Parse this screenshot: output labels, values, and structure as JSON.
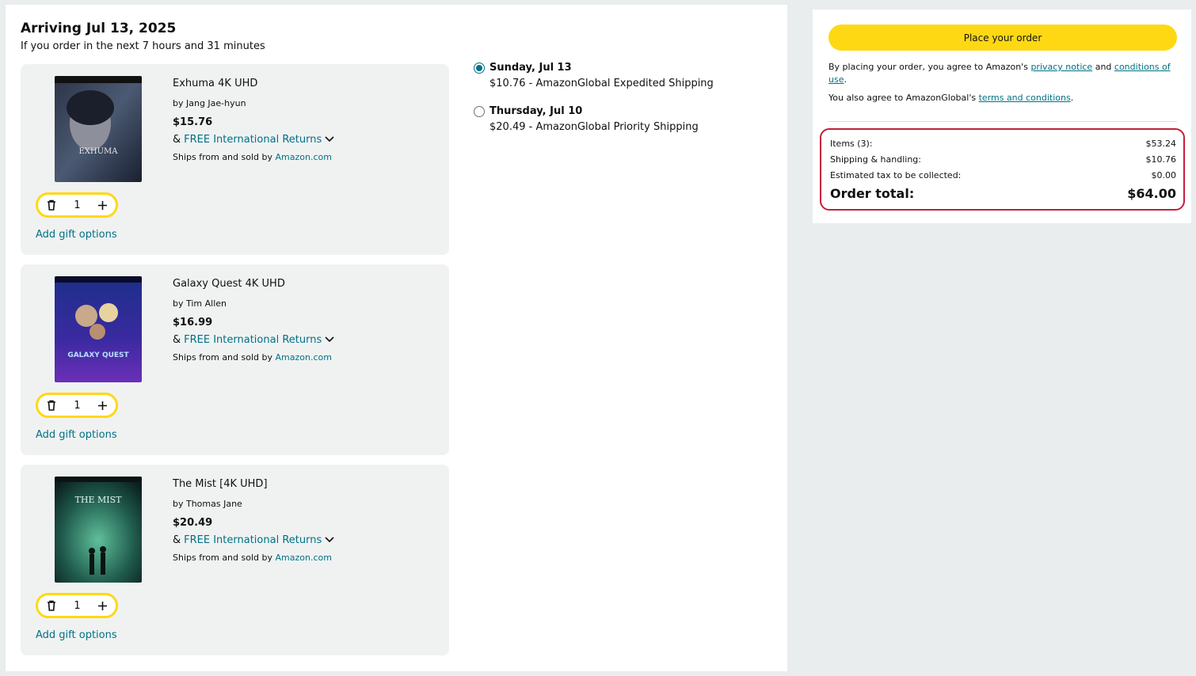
{
  "delivery": {
    "heading": "Arriving Jul 13, 2025",
    "subheading": "If you order in the next 7 hours and 31 minutes"
  },
  "items": [
    {
      "title": "Exhuma 4K UHD",
      "by": "by Jang Jae-hyun",
      "price": "$15.76",
      "returns_prefix": "& ",
      "returns_link": "FREE International Returns",
      "ships_prefix": "Ships from and sold by ",
      "seller": "Amazon.com",
      "quantity": "1",
      "gift": "Add gift options",
      "cover_text": "EXHUMA"
    },
    {
      "title": "Galaxy Quest 4K UHD",
      "by": "by Tim Allen",
      "price": "$16.99",
      "returns_prefix": "& ",
      "returns_link": "FREE International Returns",
      "ships_prefix": "Ships from and sold by ",
      "seller": "Amazon.com",
      "quantity": "1",
      "gift": "Add gift options",
      "cover_text": "GALAXY QUEST"
    },
    {
      "title": "The Mist [4K UHD]",
      "by": "by Thomas Jane",
      "price": "$20.49",
      "returns_prefix": "& ",
      "returns_link": "FREE International Returns",
      "ships_prefix": "Ships from and sold by ",
      "seller": "Amazon.com",
      "quantity": "1",
      "gift": "Add gift options",
      "cover_text": "THE MIST"
    }
  ],
  "shipping_options": [
    {
      "date": "Sunday, Jul 13",
      "desc": "$10.76 - AmazonGlobal Expedited Shipping",
      "selected": true
    },
    {
      "date": "Thursday, Jul 10",
      "desc": "$20.49 - AmazonGlobal Priority Shipping",
      "selected": false
    }
  ],
  "sidebar": {
    "place_order": "Place your order",
    "agree_1": "By placing your order, you agree to Amazon's ",
    "privacy_link": "privacy notice",
    "agree_and": " and ",
    "conditions_link": "conditions of use",
    "agree_end": ".",
    "agree_2": "You also agree to AmazonGlobal's ",
    "terms_link": "terms and conditions",
    "agree_2_end": "."
  },
  "summary": {
    "items_label": "Items (3):",
    "items_value": "$53.24",
    "shipping_label": "Shipping & handling:",
    "shipping_value": "$10.76",
    "tax_label": "Estimated tax to be collected:",
    "tax_value": "$0.00",
    "total_label": "Order total:",
    "total_value": "$64.00"
  },
  "colors": {
    "link": "#007185",
    "button": "#ffd814",
    "highlight": "#c41e3a"
  }
}
